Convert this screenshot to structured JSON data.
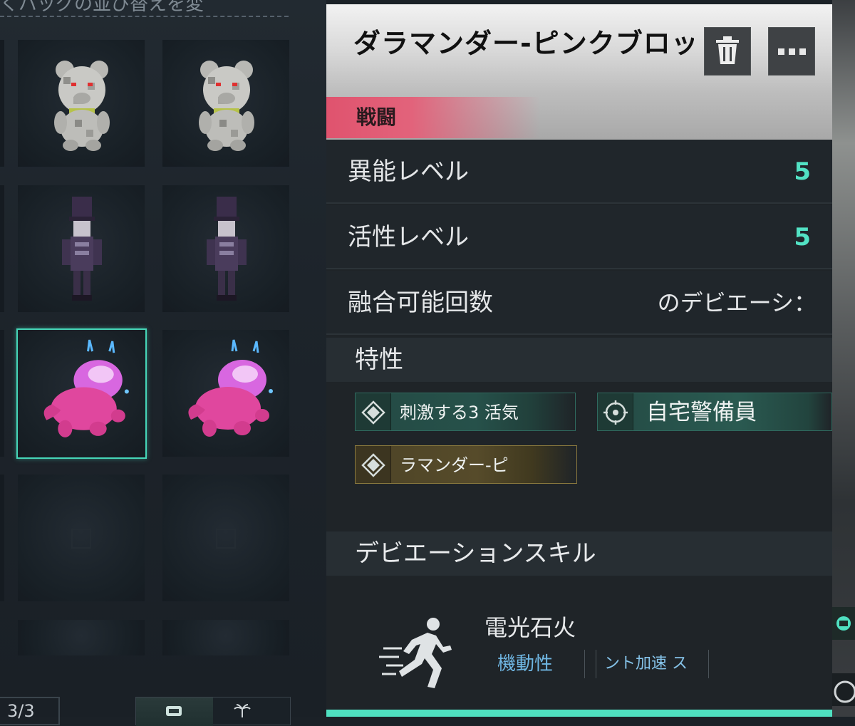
{
  "inventory": {
    "hint_text": "くバッグの並び替えを変",
    "count_text": "3/3",
    "slots": [
      {
        "item": "pixel-teddy-bear",
        "selected": false
      },
      {
        "item": "pixel-teddy-bear",
        "selected": false
      },
      {
        "item": "nutcracker-figure",
        "selected": false
      },
      {
        "item": "nutcracker-figure",
        "selected": false
      },
      {
        "item": "pink-salamander",
        "selected": true
      },
      {
        "item": "pink-salamander",
        "selected": false
      },
      {
        "item": "empty",
        "selected": false
      },
      {
        "item": "empty",
        "selected": false
      },
      {
        "item": "empty",
        "selected": false
      },
      {
        "item": "empty",
        "selected": false
      }
    ],
    "filter_icons": [
      "deviation-icon",
      "palm-tree-icon"
    ]
  },
  "detail": {
    "item_name": "ダラマンダー-ピンクブロッ",
    "category": "戦闘",
    "stats": [
      {
        "label": "異能レベル",
        "value": "5"
      },
      {
        "label": "活性レベル",
        "value": "5"
      },
      {
        "label": "融合可能回数",
        "value": "のデビエーシ："
      }
    ],
    "traits_title": "特性",
    "traits": [
      {
        "label": "刺激する3  活気",
        "icon": "diamond-icon",
        "tier": "green"
      },
      {
        "label": "自宅警備員",
        "icon": "crosshair-icon",
        "tier": "green"
      },
      {
        "label": "ラマンダー-ピ",
        "icon": "diamond-icon",
        "tier": "gold"
      }
    ],
    "skill_section_title": "デビエーションスキル",
    "skill": {
      "name": "電光石火",
      "icon": "running-figure-icon",
      "tags": [
        "機動性",
        "ント加速 ス"
      ]
    }
  },
  "colors": {
    "accent": "#4fe0c1",
    "stat_value": "#52e2c4",
    "category_badge": "#e0536e",
    "skill_tag": "#6fb6e2"
  }
}
